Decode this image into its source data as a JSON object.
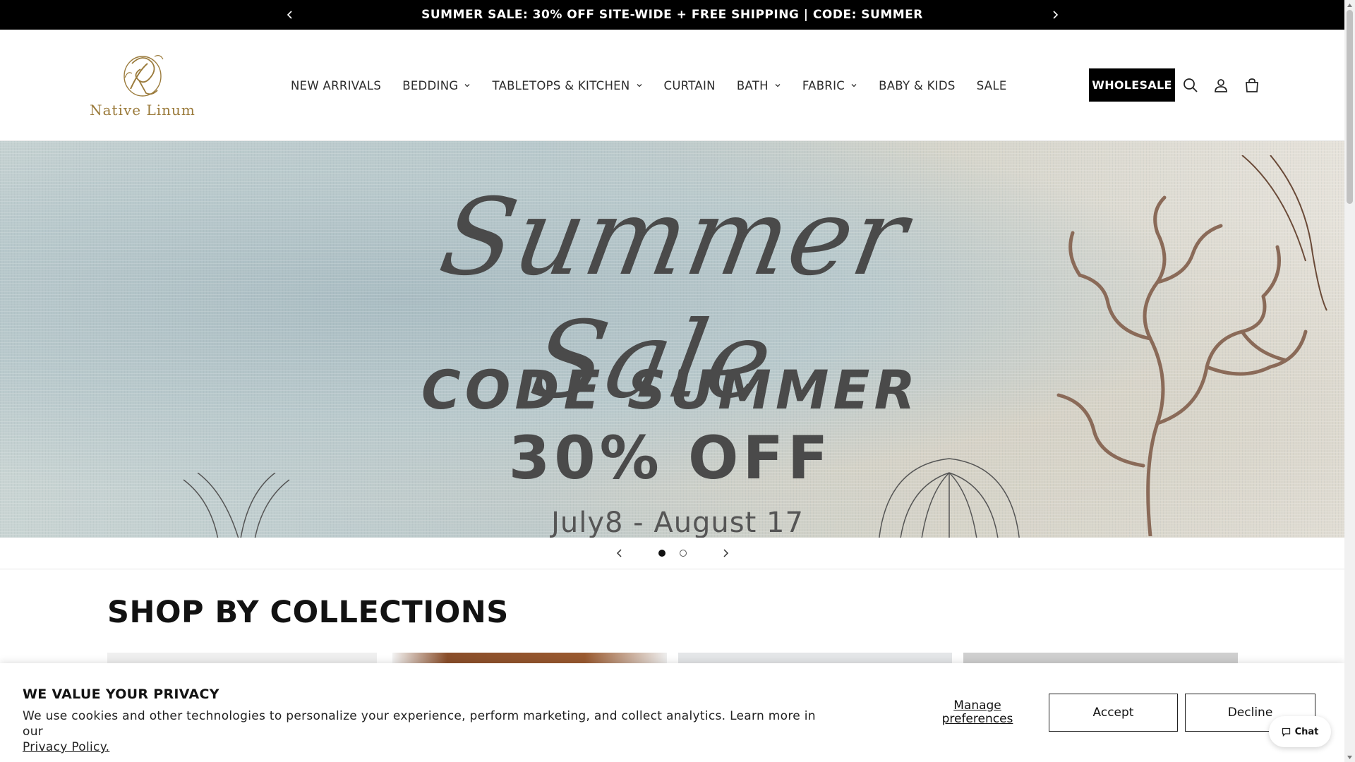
{
  "announcement": {
    "text": "SUMMER SALE: 30% OFF SITE-WIDE + FREE SHIPPING | CODE: SUMMER"
  },
  "header": {
    "logo_text": "Native Linum",
    "nav": [
      {
        "label": "NEW ARRIVALS",
        "dropdown": false
      },
      {
        "label": "BEDDING",
        "dropdown": true
      },
      {
        "label": "TABLETOPS & KITCHEN",
        "dropdown": true
      },
      {
        "label": "CURTAIN",
        "dropdown": false
      },
      {
        "label": "BATH",
        "dropdown": true
      },
      {
        "label": "FABRIC",
        "dropdown": true
      },
      {
        "label": "BABY & KIDS",
        "dropdown": false
      },
      {
        "label": "SALE",
        "dropdown": false
      }
    ],
    "wholesale_label": "WHOLESALE",
    "icons": [
      "search-icon",
      "account-icon",
      "cart-icon"
    ]
  },
  "hero": {
    "script_title": "Summer Sale",
    "code_line": "CODE SUMMER",
    "discount_line": "30% OFF",
    "dates_line": "July8 - August 17",
    "slide_count": 2,
    "active_slide": 1
  },
  "collections": {
    "title": "SHOP BY COLLECTIONS"
  },
  "cookie": {
    "title": "WE VALUE YOUR PRIVACY",
    "body": "We use cookies and other technologies to personalize your experience, perform marketing, and collect analytics. Learn more in our",
    "link": "Privacy Policy.",
    "manage_label": "Manage preferences",
    "accept_label": "Accept",
    "decline_label": "Decline"
  },
  "chat": {
    "label": "Chat"
  },
  "colors": {
    "announcement_bg": "#000000",
    "logo_gold": "#9b7b3c",
    "hero_text": "#4a4a4a",
    "coral": "#8a6a58"
  }
}
